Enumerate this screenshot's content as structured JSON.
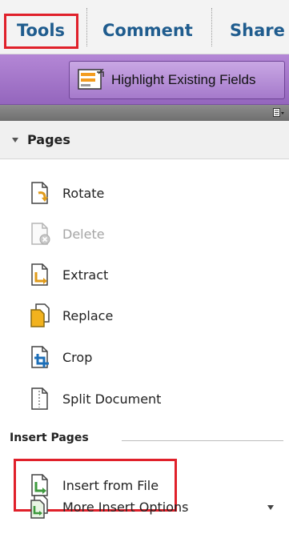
{
  "tabs": {
    "tools": "Tools",
    "comment": "Comment",
    "share": "Share"
  },
  "toolbar": {
    "highlight_existing_fields": "Highlight Existing Fields"
  },
  "pages_section": {
    "title": "Pages",
    "items": [
      {
        "label": "Rotate",
        "icon": "rotate-icon"
      },
      {
        "label": "Delete",
        "icon": "delete-icon",
        "disabled": true
      },
      {
        "label": "Extract",
        "icon": "extract-icon"
      },
      {
        "label": "Replace",
        "icon": "replace-icon"
      },
      {
        "label": "Crop",
        "icon": "crop-icon"
      },
      {
        "label": "Split Document",
        "icon": "split-document-icon"
      }
    ]
  },
  "insert_pages": {
    "title": "Insert Pages",
    "items": [
      {
        "label": "Insert from File",
        "icon": "insert-from-file-icon"
      },
      {
        "label": "More Insert Options",
        "icon": "more-insert-options-icon"
      }
    ]
  },
  "colors": {
    "tab_text": "#1f5c8e",
    "highlight_box": "#e0202a",
    "toolbar_purple": "#9466bd"
  }
}
